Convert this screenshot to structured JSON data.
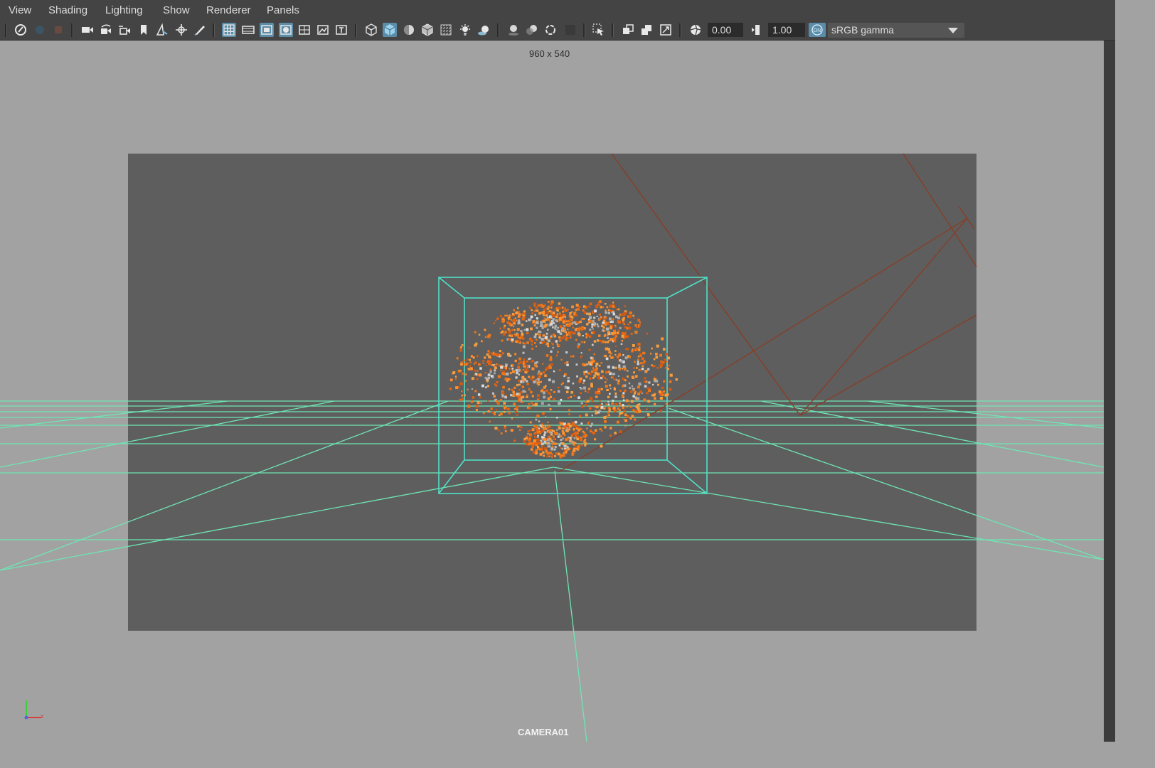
{
  "menu": {
    "items": [
      "View",
      "Shading",
      "Lighting",
      "Show",
      "Renderer",
      "Panels"
    ]
  },
  "toolbar": {
    "exposure_value": "0.00",
    "gamma_value": "1.00",
    "color_management_toggle": "ON",
    "color_space": "sRGB gamma"
  },
  "viewport": {
    "resolution_label": "960 x 540",
    "camera_label": "CAMERA01"
  },
  "colors": {
    "ui_bar": "#444444",
    "viewport_bg": "#a2a2a2",
    "resolution_gate": "#5e5e5e",
    "grid_lines": "#6ee6b4",
    "bounding_box": "#4fe0c8",
    "light_lines": "#8a3c24",
    "fx_orange": "#f07818",
    "active_icon": "#5b8da8"
  },
  "icons": [
    "select-camera-icon",
    "camera-attributes-icon",
    "bookmark-icon",
    "camera-icon",
    "camera-tumble-icon",
    "camera-track-icon",
    "bookmark-flag-icon",
    "image-plane-icon",
    "2d-pan-icon",
    "grease-pencil-icon",
    "grid-icon",
    "film-gate-icon",
    "resolution-gate-icon",
    "gate-mask-icon",
    "field-chart-icon",
    "safe-action-icon",
    "safe-title-icon",
    "wireframe-icon",
    "smooth-shade-icon",
    "default-material-icon",
    "wireframe-on-shaded-icon",
    "xray-icon",
    "use-all-lights-icon",
    "shadows-icon",
    "screen-space-ao-icon",
    "motion-blur-icon",
    "antialiasing-icon",
    "depth-of-field-icon",
    "isolate-select-icon",
    "xray-joints-icon",
    "xray-active-icon",
    "backface-culling-icon",
    "exposure-icon",
    "gamma-icon",
    "color-management-icon",
    "dropdown-arrow-icon",
    "axis-indicator-icon"
  ]
}
